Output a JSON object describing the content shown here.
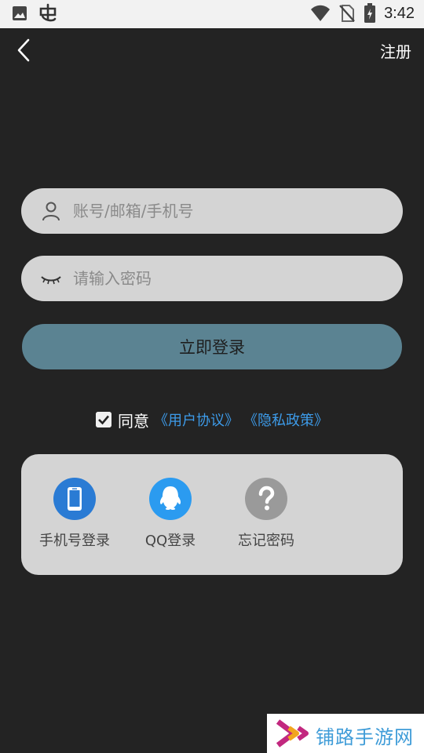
{
  "status_bar": {
    "time": "3:42",
    "left_icons": [
      "image-icon",
      "bug-icon"
    ],
    "right_icons": [
      "wifi-icon",
      "no-sim-icon",
      "battery-charging-icon"
    ]
  },
  "header": {
    "back_icon": "chevron-left-icon",
    "register_label": "注册"
  },
  "form": {
    "account_placeholder": "账号/邮箱/手机号",
    "password_placeholder": "请输入密码",
    "login_label": "立即登录"
  },
  "agreement": {
    "checked": true,
    "agree_label": "同意",
    "user_agreement": "《用户协议》",
    "privacy_policy": "《隐私政策》"
  },
  "login_options": [
    {
      "label": "手机号登录",
      "icon": "phone-icon",
      "color": "#2a7bd4"
    },
    {
      "label": "QQ登录",
      "icon": "qq-icon",
      "color": "#2b9bf0"
    },
    {
      "label": "忘记密码",
      "icon": "question-icon",
      "color": "#9a9a9a"
    }
  ],
  "watermark": {
    "text": "铺路手游网"
  },
  "colors": {
    "background": "#232323",
    "field": "#d4d4d4",
    "login_button": "#5b8392",
    "link": "#3d9be9"
  }
}
